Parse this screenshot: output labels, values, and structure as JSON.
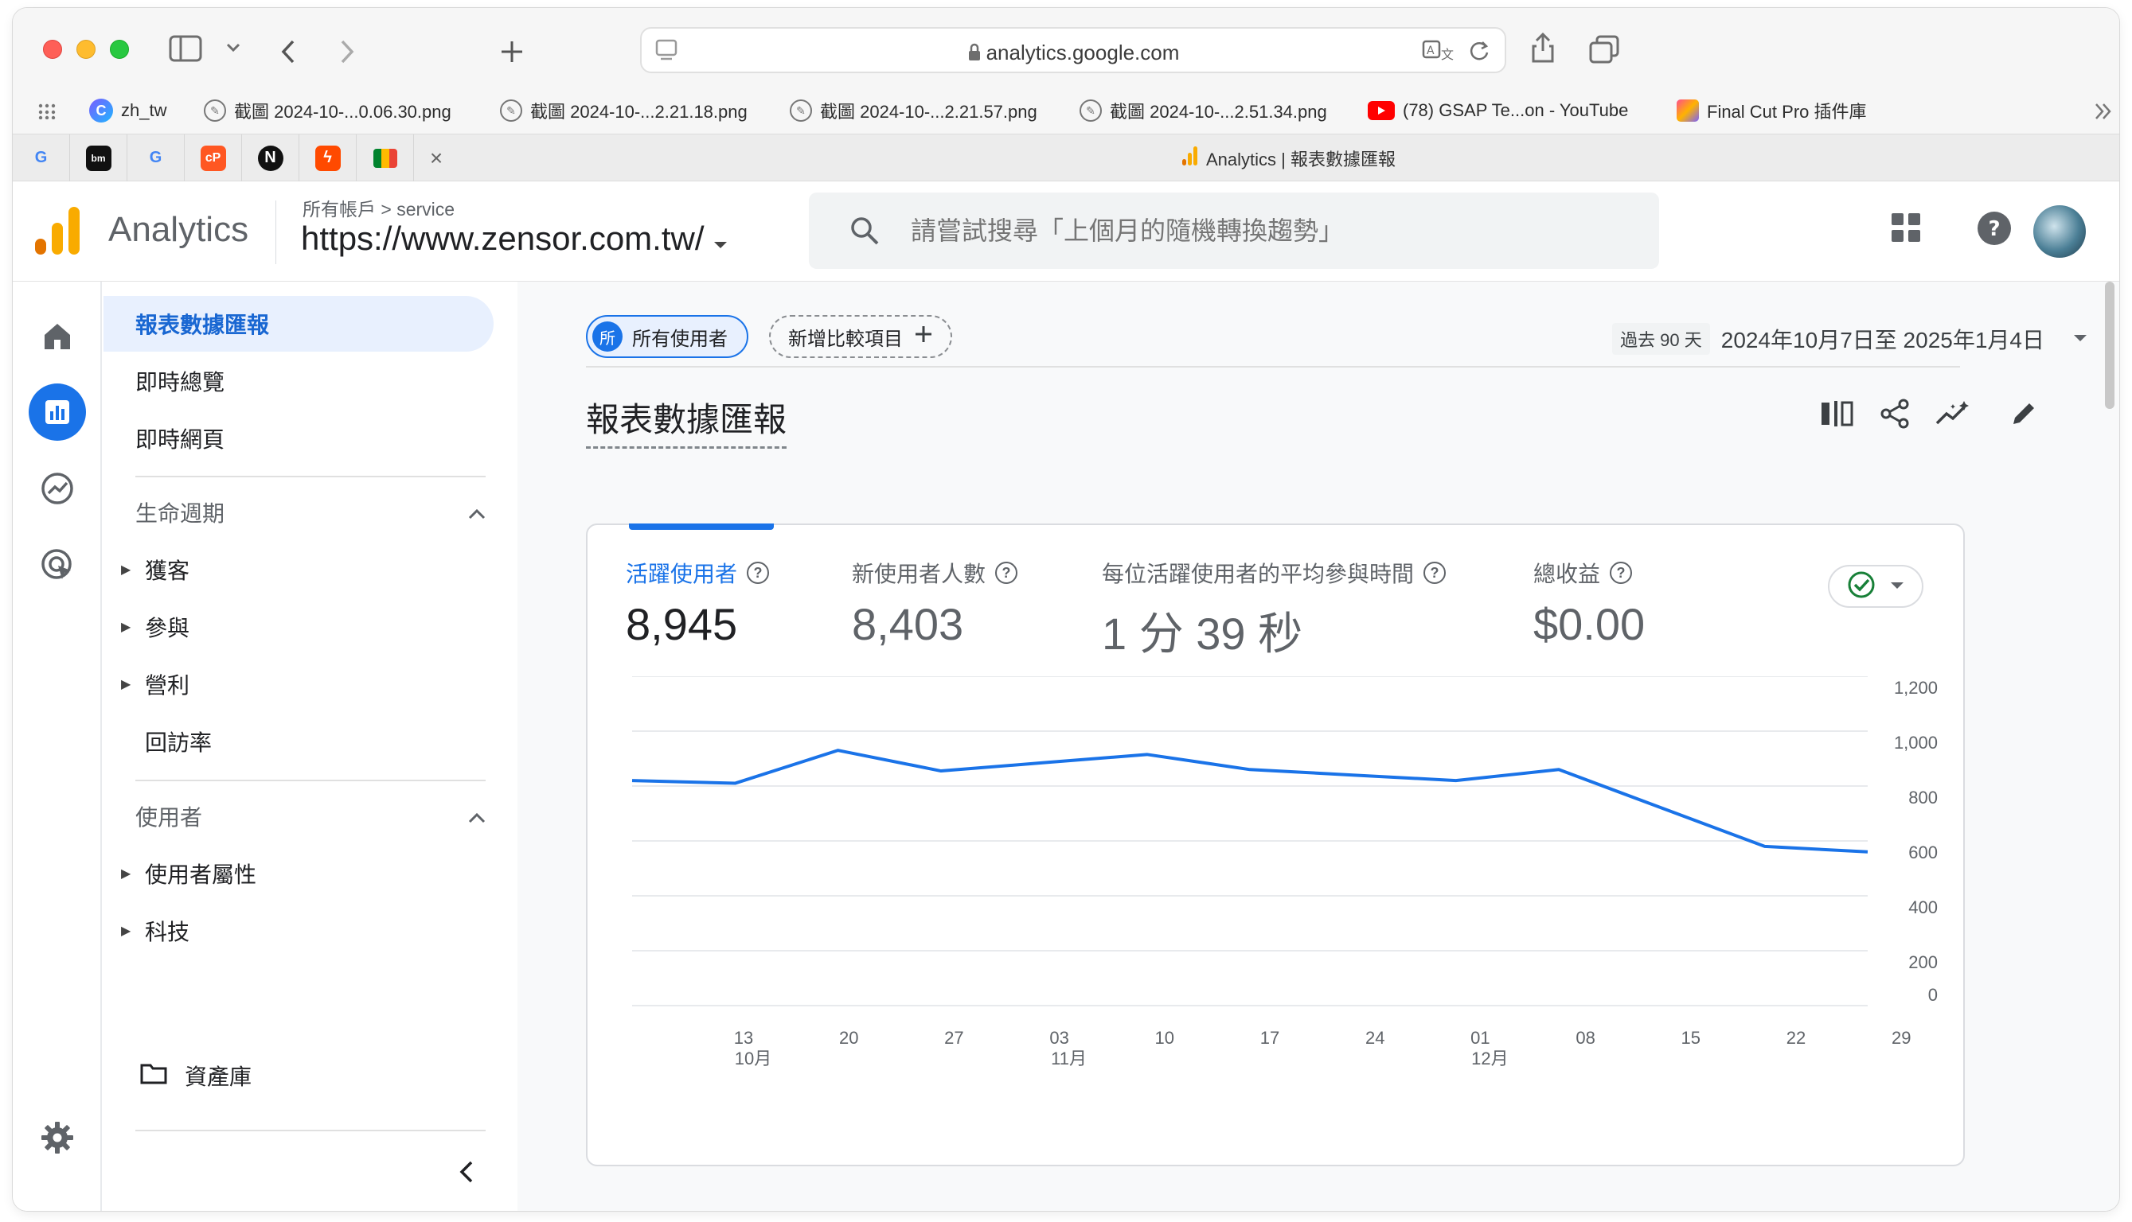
{
  "browser": {
    "url": "analytics.google.com",
    "bookmarks": [
      {
        "label": "zh_tw",
        "icon": "chatgpt-icon"
      },
      {
        "label": "截圖 2024-10-...0.06.30.png",
        "icon": "compass-icon"
      },
      {
        "label": "截圖 2024-10-...2.21.18.png",
        "icon": "compass-icon"
      },
      {
        "label": "截圖 2024-10-...2.21.57.png",
        "icon": "compass-icon"
      },
      {
        "label": "截圖 2024-10-...2.51.34.png",
        "icon": "compass-icon"
      },
      {
        "label": "(78) GSAP Te...on - YouTube",
        "icon": "youtube-icon"
      },
      {
        "label": "Final Cut Pro 插件庫",
        "icon": "clapper-icon"
      }
    ],
    "pinned_tabs": [
      "google-icon",
      "bitmex-icon",
      "google-icon",
      "copilot-icon",
      "notion-icon",
      "zapier-icon",
      "meet-icon"
    ],
    "active_tab_title": "Analytics | 報表數據匯報",
    "close_glyph": "×"
  },
  "header": {
    "app_name": "Analytics",
    "breadcrumb": "所有帳戶 > service",
    "property": "https://www.zensor.com.tw/",
    "search_placeholder": "請嘗試搜尋「上個月的隨機轉換趨勢」"
  },
  "nav": {
    "items": [
      {
        "label": "報表數據匯報",
        "active": true
      },
      {
        "label": "即時總覽"
      },
      {
        "label": "即時網頁"
      }
    ],
    "section_lifecycle": "生命週期",
    "lifecycle_items": [
      "獲客",
      "參與",
      "營利"
    ],
    "lifecycle_plain": "回訪率",
    "section_user": "使用者",
    "user_items": [
      "使用者屬性",
      "科技"
    ],
    "library": "資產庫"
  },
  "main": {
    "chip_all_avatar": "所",
    "chip_all": "所有使用者",
    "chip_add": "新增比較項目",
    "date_badge": "過去 90 天",
    "date_range": "2024年10月7日至 2025年1月4日",
    "title": "報表數據匯報"
  },
  "metrics": [
    {
      "label": "活躍使用者",
      "value": "8,945",
      "selected": true
    },
    {
      "label": "新使用者人數",
      "value": "8,403"
    },
    {
      "label": "每位活躍使用者的平均參與時間",
      "value": "1 分 39 秒"
    },
    {
      "label": "總收益",
      "value": "$0.00"
    }
  ],
  "colors": {
    "accent": "#1a73e8",
    "line": "#1a73e8",
    "check": "#188038"
  },
  "chart_data": {
    "type": "line",
    "series": [
      {
        "values": [
          820,
          810,
          930,
          855,
          885,
          915,
          860,
          840,
          820,
          860,
          720,
          580,
          560
        ]
      }
    ],
    "x": [
      "13",
      "20",
      "27",
      "03",
      "10",
      "17",
      "24",
      "01",
      "08",
      "15",
      "22",
      "29"
    ],
    "x_labels": [
      "13",
      "20",
      "27",
      "03",
      "10",
      "17",
      "24",
      "01",
      "08",
      "15",
      "22",
      "29"
    ],
    "x_sub_labels": [
      {
        "tick": "13",
        "label": "10月"
      },
      {
        "tick": "03",
        "label": "11月"
      },
      {
        "tick": "01",
        "label": "12月"
      }
    ],
    "y_ticks": [
      "1,200",
      "1,000",
      "800",
      "600",
      "400",
      "200",
      "0"
    ],
    "ylim": [
      0,
      1200
    ],
    "grid": true
  }
}
